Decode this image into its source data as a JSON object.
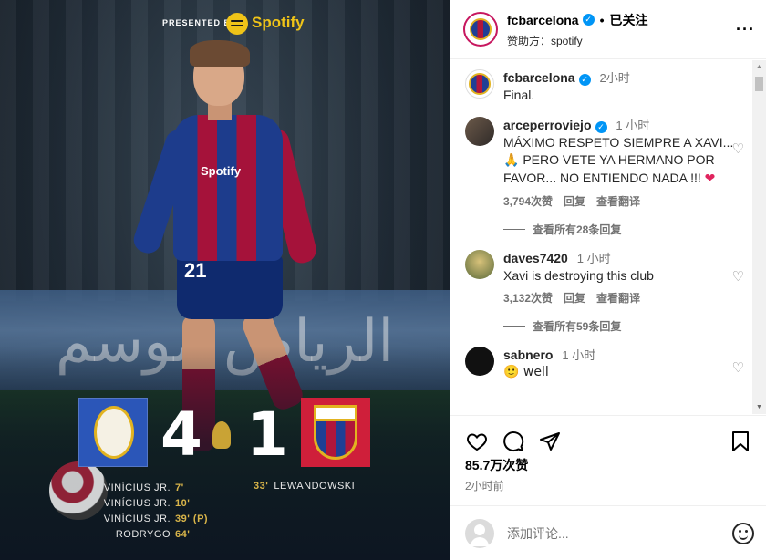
{
  "media": {
    "presented_by": "PRESENTED BY",
    "sponsor_brand": "Spotify",
    "shirt_sponsor": "Spotify",
    "shirt_number": "21",
    "ad_text": "ﺍﻟﺮﻳﺎﺽ ﻣﻮﺳﻢ",
    "home_score": "4",
    "away_score": "1",
    "home_scorers": [
      {
        "name": "VINÍCIUS JR.",
        "minute": "7'"
      },
      {
        "name": "VINÍCIUS JR.",
        "minute": "10'"
      },
      {
        "name": "VINÍCIUS JR.",
        "minute": "39' (P)"
      },
      {
        "name": "RODRYGO",
        "minute": "64'"
      }
    ],
    "away_scorer": {
      "name": "LEWANDOWSKI",
      "minute": "33'"
    },
    "colors": {
      "rm_blue": "#2b56b8",
      "fcb_red": "#cf1f3a",
      "gold": "#d9b54a",
      "spotify": "#f0c418"
    }
  },
  "header": {
    "username": "fcbarcelona",
    "separator": "•",
    "follow_status": "已关注",
    "sponsor_line": "赞助方：spotify",
    "more_icon": "more-horizontal-icon"
  },
  "caption": {
    "username": "fcbarcelona",
    "time": "2小时",
    "text": "Final."
  },
  "comments": [
    {
      "username": "arceperroviejo",
      "time": "1 小时",
      "text_a": "MÁXIMO RESPETO SIEMPRE A XAVI... ",
      "emoji_a": "🙏",
      "text_b": " PERO VETE YA HERMANO POR FAVOR... NO ENTIENDO NADA !!! ",
      "emoji_b": "❤",
      "likes": "3,794次赞",
      "reply": "回复",
      "translate": "查看翻译",
      "view_replies": "查看所有28条回复"
    },
    {
      "username": "daves7420",
      "time": "1 小时",
      "text": "Xavi is destroying this club",
      "likes": "3,132次赞",
      "reply": "回复",
      "translate": "查看翻译",
      "view_replies": "查看所有59条回复"
    },
    {
      "username": "sabnero",
      "time": "1 小时",
      "text": "🙂 well"
    }
  ],
  "actions": {
    "likes_count": "85.7万次赞",
    "posted_ago": "2小时前"
  },
  "add_comment": {
    "placeholder": "添加评论..."
  },
  "brand": {
    "verified_blue": "#0095f6",
    "muted": "#737373"
  }
}
